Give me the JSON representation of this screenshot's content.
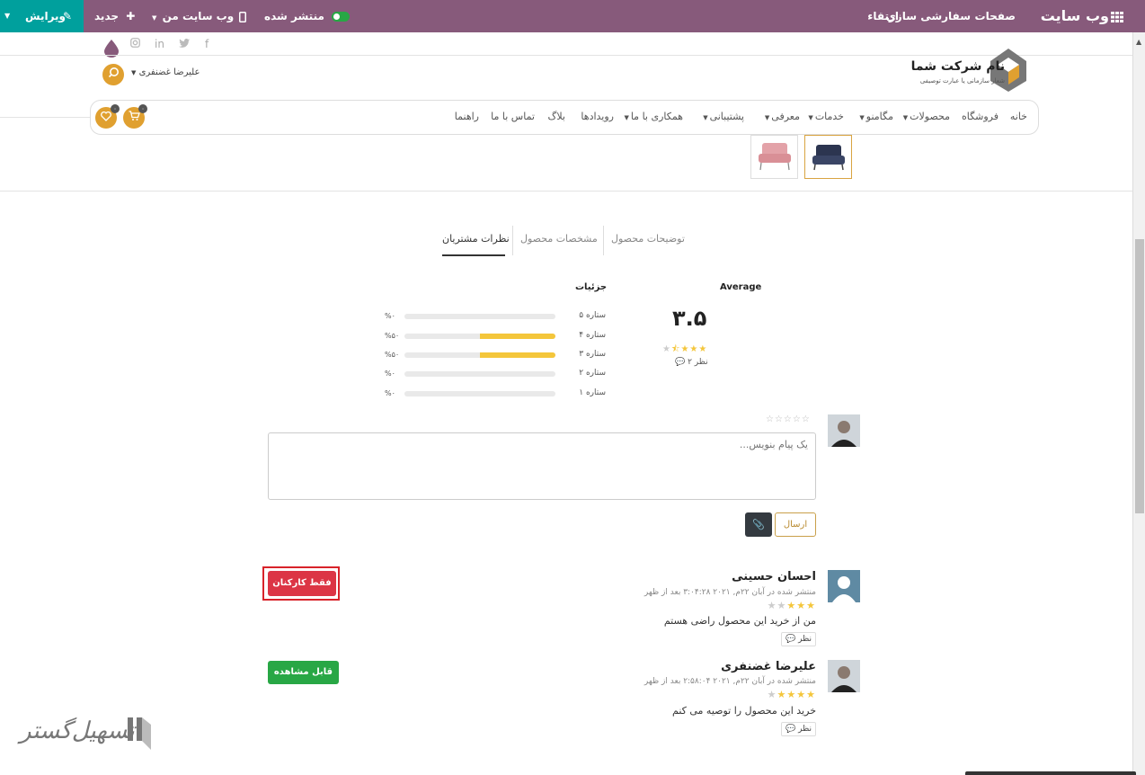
{
  "topbar": {
    "app_title": "وب سایت",
    "menu_pages": "صفحات",
    "menu_customize": "سفارشی سازی",
    "menu_upgrade": "ارتقاء",
    "published_label": "منتشر شده",
    "my_website_label": "وب سایت من",
    "new_label": "جدید",
    "edit_label": "ویرایش",
    "bg_color": "#875a7b",
    "edit_color": "#00a09d"
  },
  "header": {
    "company_name": "نام شرکت شما",
    "company_slogan": "شعار سازمانی یا عبارت توصیفی",
    "username": "علیرضا غضنفری",
    "social_icons": [
      "facebook-icon",
      "twitter-icon",
      "linkedin-icon",
      "instagram-icon"
    ]
  },
  "nav": {
    "items": [
      "خانه",
      "فروشگاه",
      "محصولات",
      "مگامنو",
      "خدمات",
      "معرفی",
      "پشتیبانی",
      "همکاری با ما",
      "رویدادها",
      "بلاگ",
      "تماس با ما",
      "راهنما"
    ],
    "cart_count": "۰",
    "wishlist_count": "۰"
  },
  "tabs": {
    "description": "توضیحات محصول",
    "specs": "مشخصات محصول",
    "reviews": "نظرات مشتریان"
  },
  "ratings": {
    "average_label": "Average",
    "average_value": "۳.۵",
    "average_stars": 3.5,
    "review_count": "۲ نظر",
    "details_label": "جزئیات",
    "bars": [
      {
        "label": "۵ ستاره",
        "percent": 0,
        "pct_text": "%۰"
      },
      {
        "label": "۴ ستاره",
        "percent": 50,
        "pct_text": "%۵۰"
      },
      {
        "label": "۳ ستاره",
        "percent": 50,
        "pct_text": "%۵۰"
      },
      {
        "label": "۲ ستاره",
        "percent": 0,
        "pct_text": "%۰"
      },
      {
        "label": "۱ ستاره",
        "percent": 0,
        "pct_text": "%۰"
      }
    ]
  },
  "composer": {
    "placeholder": "یک پیام بنویس...",
    "send_label": "ارسال"
  },
  "reviews": [
    {
      "name": "احسان حسینی",
      "meta": "منتشر شده در آبان ۲۲م, ۲۰۲۱ ۳:۰۴:۲۸ بعد از ظهر",
      "stars": 3,
      "text": "من از خرید این محصول راضی هستم",
      "comment_label": "نظر",
      "status_label": "فقط کارکنان",
      "status_color": "#dc3545"
    },
    {
      "name": "علیرضا غضنفری",
      "meta": "منتشر شده در آبان ۲۲م, ۲۰۲۱ ۲:۵۸:۰۴ بعد از ظهر",
      "stars": 4,
      "text": "خرید این محصول را توصیه می کنم",
      "comment_label": "نظر",
      "status_label": "قابل مشاهده",
      "status_color": "#28a745"
    }
  ],
  "watermark": {
    "text": "تسهیل‌گستر"
  }
}
